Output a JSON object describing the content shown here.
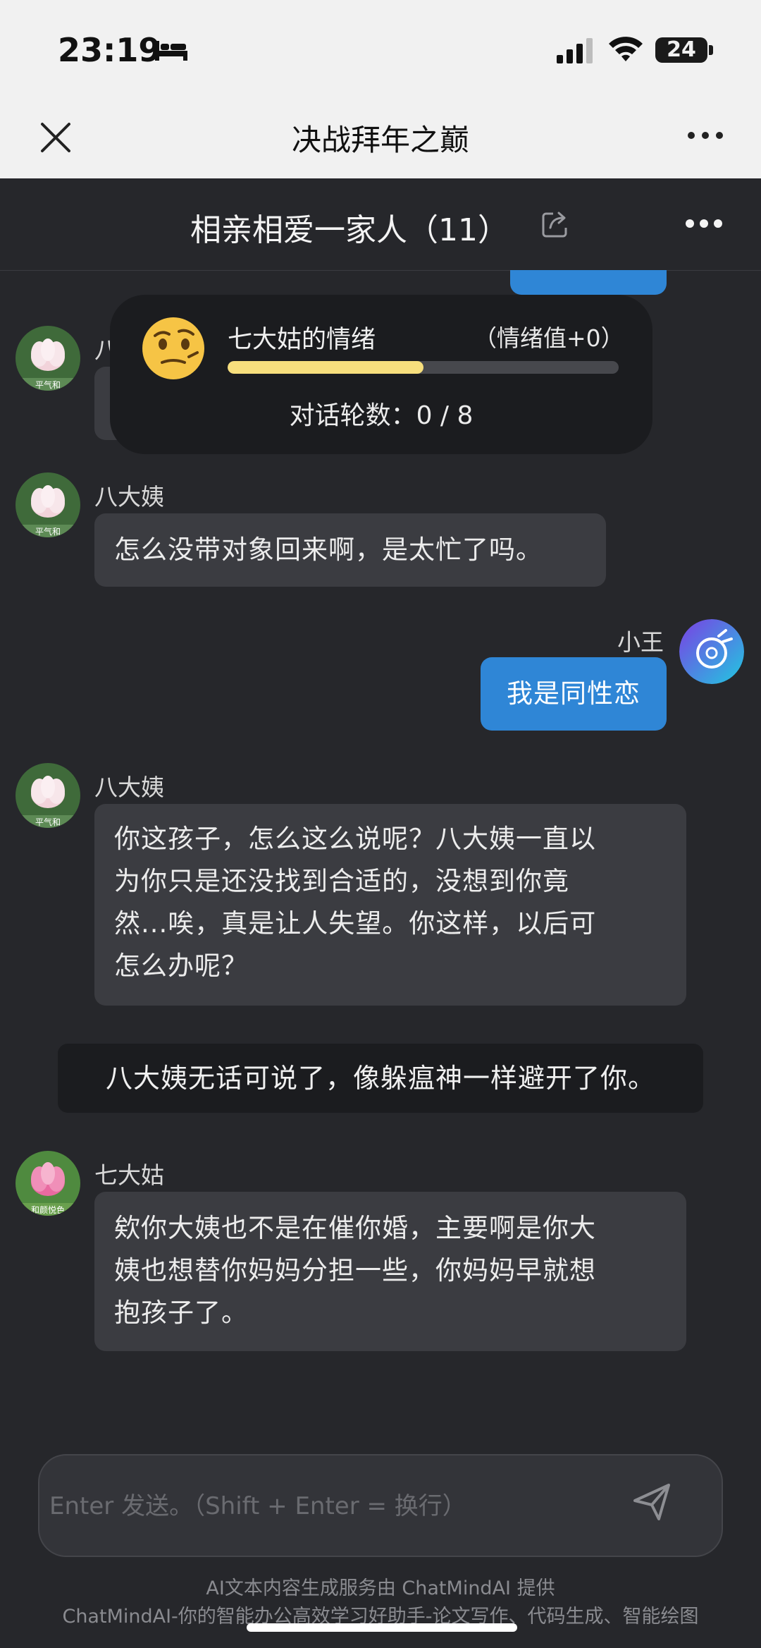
{
  "status_bar": {
    "time": "23:19",
    "battery": "24"
  },
  "nav": {
    "title": "决战拜年之巅"
  },
  "chat": {
    "group_title": "相亲相爱一家人（11）"
  },
  "emotion": {
    "name": "七大姑的情绪",
    "value_label": "（情绪值+0）",
    "level": 0.5,
    "rounds_label": "对话轮数：0 / 8"
  },
  "messages": {
    "m1": {
      "sender": "八大姨"
    },
    "m2": {
      "sender": "八大姨",
      "text": "怎么没带对象回来啊，是太忙了吗。"
    },
    "m3": {
      "sender": "小王",
      "text": "我是同性恋"
    },
    "m4": {
      "sender": "八大姨",
      "lines": [
        "你这孩子，怎么这么说呢？八大姨一直以",
        "为你只是还没找到合适的，没想到你竟",
        "然...唉，真是让人失望。你这样，以后可",
        "怎么办呢？"
      ]
    },
    "m5": {
      "text": "八大姨无话可说了，像躲瘟神一样避开了你。"
    },
    "m6": {
      "sender": "七大姑",
      "lines": [
        "欸你大姨也不是在催你婚，主要啊是你大",
        "姨也想替你妈妈分担一些，你妈妈早就想",
        "抱孩子了。"
      ]
    }
  },
  "avatar_text": {
    "a": "平气和",
    "b": "和颜悦色"
  },
  "input": {
    "placeholder": "Enter 发送。（Shift + Enter = 换行）"
  },
  "footer": {
    "line1": "AI文本内容生成服务由 ChatMindAI 提供",
    "line2": "ChatMindAI-你的智能办公高效学习好助手-论文写作、代码生成、智能绘图"
  }
}
